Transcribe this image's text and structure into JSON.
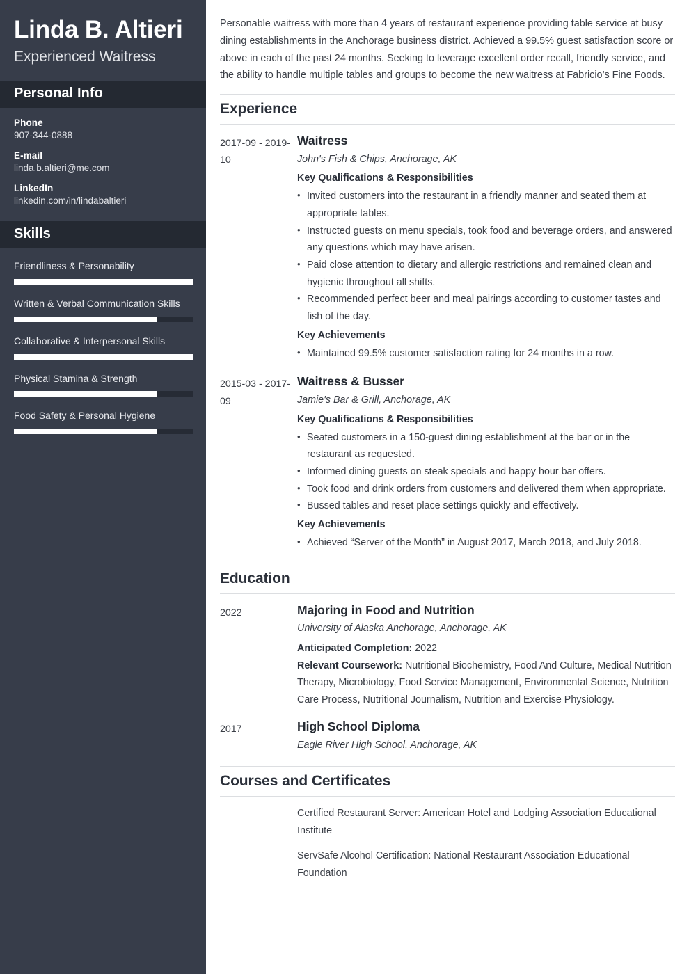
{
  "sidebar": {
    "full_name": "Linda B. Altieri",
    "job_title": "Experienced Waitress",
    "personal_info": {
      "heading": "Personal Info",
      "items": [
        {
          "label": "Phone",
          "value": "907-344-0888"
        },
        {
          "label": "E-mail",
          "value": "linda.b.altieri@me.com"
        },
        {
          "label": "LinkedIn",
          "value": "linkedin.com/in/lindabaltieri"
        }
      ]
    },
    "skills": {
      "heading": "Skills",
      "items": [
        {
          "name": "Friendliness & Personability",
          "level": 100
        },
        {
          "name": "Written & Verbal Communication Skills",
          "level": 80
        },
        {
          "name": "Collaborative & Interpersonal Skills",
          "level": 100
        },
        {
          "name": "Physical Stamina & Strength",
          "level": 80
        },
        {
          "name": "Food Safety & Personal Hygiene",
          "level": 80
        }
      ]
    }
  },
  "main": {
    "summary": "Personable waitress with more than 4 years of restaurant experience providing table service at busy dining establishments in the Anchorage business district. Achieved a 99.5% guest satisfaction score or above in each of the past 24 months. Seeking to leverage excellent order recall, friendly service, and the ability to handle multiple tables and groups to become the new waitress at Fabricio’s Fine Foods.",
    "experience": {
      "heading": "Experience",
      "entries": [
        {
          "date": "2017-09 - 2019-10",
          "role": "Waitress",
          "org": "John's Fish & Chips, Anchorage, AK",
          "qualifications_heading": "Key Qualifications & Responsibilities",
          "bullets": [
            "Invited customers into the restaurant in a friendly manner and seated them at appropriate tables.",
            "Instructed guests on menu specials, took food and beverage orders, and answered any questions which may have arisen.",
            "Paid close attention to dietary and allergic restrictions and remained clean and hygienic throughout all shifts.",
            "Recommended perfect beer and meal pairings according to customer tastes and fish of the day."
          ],
          "achievements_heading": "Key Achievements",
          "achievements": [
            "Maintained 99.5% customer satisfaction rating for 24 months in a row."
          ]
        },
        {
          "date": "2015-03 - 2017-09",
          "role": "Waitress & Busser",
          "org": "Jamie's Bar & Grill, Anchorage, AK",
          "qualifications_heading": "Key Qualifications & Responsibilities",
          "bullets": [
            "Seated customers in a 150-guest dining establishment at the bar or in the restaurant as requested.",
            "Informed dining guests on steak specials and happy hour bar offers.",
            "Took food and drink orders from customers and delivered them when appropriate.",
            "Bussed tables and reset place settings quickly and effectively."
          ],
          "achievements_heading": "Key Achievements",
          "achievements": [
            "Achieved “Server of the Month” in August 2017, March 2018, and July 2018."
          ]
        }
      ]
    },
    "education": {
      "heading": "Education",
      "entries": [
        {
          "date": "2022",
          "degree": "Majoring in Food and Nutrition",
          "school": "University of Alaska Anchorage, Anchorage, AK",
          "completion_label": "Anticipated Completion:",
          "completion_value": "2022",
          "coursework_label": "Relevant Coursework:",
          "coursework_value": "Nutritional Biochemistry, Food And Culture, Medical Nutrition Therapy, Microbiology, Food Service Management, Environmental Science, Nutrition Care Process, Nutritional Journalism, Nutrition and Exercise Physiology."
        },
        {
          "date": "2017",
          "degree": "High School Diploma",
          "school": "Eagle River High School, Anchorage, AK"
        }
      ]
    },
    "courses": {
      "heading": "Courses and Certificates",
      "items": [
        "Certified Restaurant Server: American Hotel and Lodging Association Educational Institute",
        "ServSafe Alcohol Certification: National Restaurant Association Educational Foundation"
      ]
    }
  }
}
